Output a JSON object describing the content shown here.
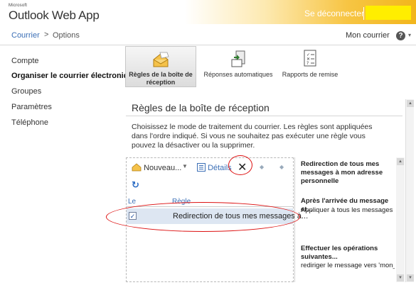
{
  "header": {
    "brand_small": "Microsoft",
    "app_title": "Outlook Web App",
    "signout": "Se déconnecter"
  },
  "breadcrumb": {
    "root": "Courrier",
    "separator": ">",
    "current": "Options",
    "mailbox": "Mon courrier",
    "help": "?",
    "caret": "▾"
  },
  "nav": {
    "items": [
      {
        "label": "Compte"
      },
      {
        "label": "Organiser le courrier électronique"
      },
      {
        "label": "Groupes"
      },
      {
        "label": "Paramètres"
      },
      {
        "label": "Téléphone"
      }
    ]
  },
  "ribbon": {
    "items": [
      {
        "label": "Règles de la boîte de réception",
        "icon": "inbox-rules-icon"
      },
      {
        "label": "Réponses automatiques",
        "icon": "auto-reply-icon"
      },
      {
        "label": "Rapports de remise",
        "icon": "delivery-reports-icon"
      }
    ]
  },
  "panel": {
    "title": "Règles de la boîte de réception",
    "description": "Choisissez le mode de traitement du courrier. Les règles sont appliquées dans l'ordre indiqué. Si vous ne souhaitez pas exécuter une règle vous pouvez la désactiver ou la supprimer."
  },
  "rules_toolbar": {
    "new_label": "Nouveau...",
    "details_label": "Détails",
    "delete_glyph": "✕"
  },
  "rules_table": {
    "col_on": "Le",
    "col_rule": "Règle",
    "rows": [
      {
        "checked": "✓",
        "rule": "Redirection de tous mes messages à..."
      }
    ]
  },
  "detail": {
    "title": "Redirection de tous mes messages à mon adresse personnelle",
    "when_heading": "Après l'arrivée du message et...",
    "when_value": "Appliquer à tous les messages",
    "do_heading": "Effectuer les opérations suivantes...",
    "do_value": "rediriger le message vers 'mon_adr_perso@cgocab"
  },
  "colors": {
    "accent_link": "#3b6fb6",
    "header_orange": "#f2b61c",
    "annotation_red": "#d11111",
    "redaction_yellow": "#ffee00"
  }
}
